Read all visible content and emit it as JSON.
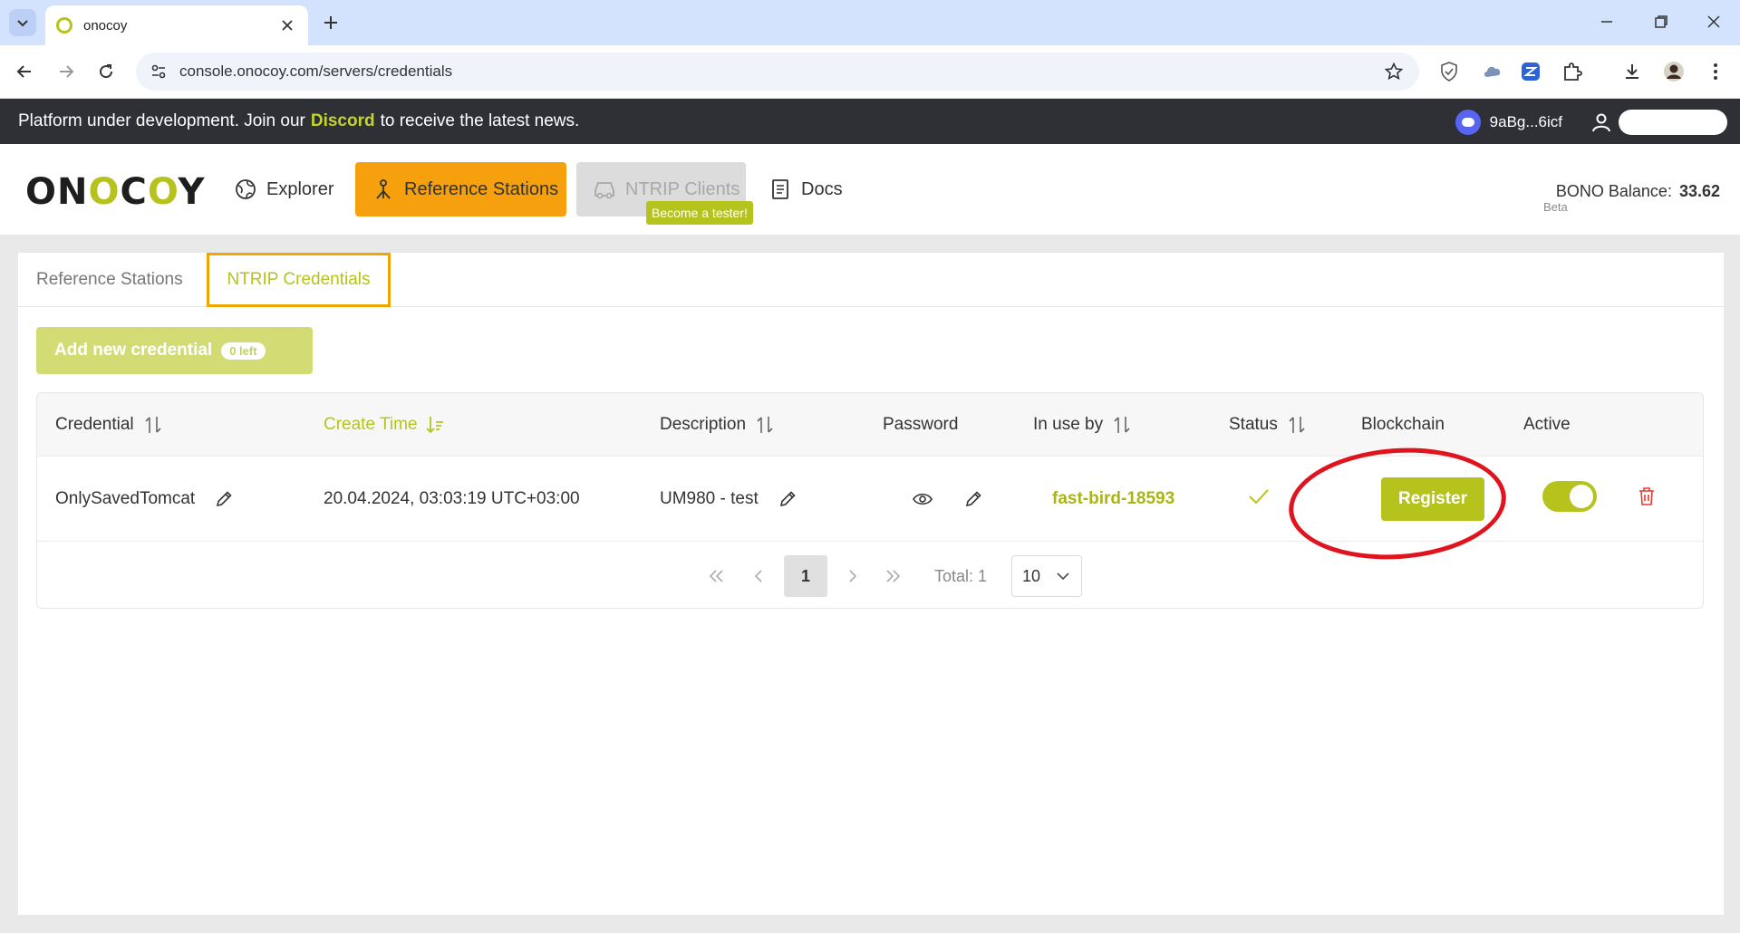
{
  "browser": {
    "tab_title": "onocoy",
    "url": "console.onocoy.com/servers/credentials"
  },
  "announcement": {
    "prefix": "Platform under development. Join our",
    "link": "Discord",
    "suffix": "to receive the latest news.",
    "wallet": "9aBg...6icf"
  },
  "header": {
    "logo": {
      "a": "ON",
      "b": "O",
      "c": "C",
      "d": "O",
      "e": "Y"
    },
    "nav": {
      "explorer": "Explorer",
      "reference_stations": "Reference Stations",
      "ntrip_clients": "NTRIP Clients",
      "tester_badge": "Become a tester!",
      "docs": "Docs"
    },
    "balance_label": "BONO Balance:",
    "balance_value": "33.62",
    "beta": "Beta"
  },
  "subtabs": {
    "reference_stations": "Reference Stations",
    "ntrip_credentials": "NTRIP Credentials"
  },
  "add_button": {
    "label": "Add new credential",
    "badge": "0 left"
  },
  "table": {
    "columns": {
      "credential": "Credential",
      "create_time": "Create Time",
      "description": "Description",
      "password": "Password",
      "in_use_by": "In use by",
      "status": "Status",
      "blockchain": "Blockchain",
      "active": "Active"
    },
    "rows": [
      {
        "credential": "OnlySavedTomcat",
        "create_time": "20.04.2024, 03:03:19 UTC+03:00",
        "description": "UM980 - test",
        "in_use_by": "fast-bird-18593",
        "blockchain_action": "Register"
      }
    ]
  },
  "pagination": {
    "current_page": "1",
    "total": "Total: 1",
    "page_size": "10"
  },
  "colors": {
    "brand_green": "#b6c31d",
    "orange": "#f5a00c",
    "annotation_red": "#e0141e"
  }
}
